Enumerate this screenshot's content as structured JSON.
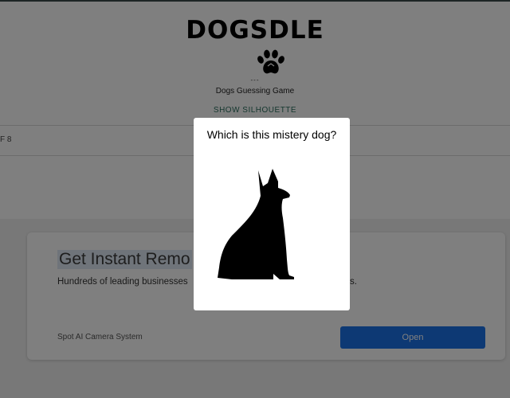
{
  "header": {
    "title": "DOGSDLE",
    "logo_icon": "paw-icon",
    "dashes": "---",
    "subtitle": "Dogs Guessing Game",
    "show_silhouette_label": "SHOW SILHOUETTE"
  },
  "game": {
    "progress_fragment": "F 8"
  },
  "ad": {
    "headline": "Get Instant Remo",
    "description": "Hundreds of leading businesses",
    "description_end": "s.",
    "brand": "Spot AI Camera System",
    "open_label": "Open"
  },
  "modal": {
    "title": "Which is this mistery dog?",
    "image_icon": "dog-silhouette-icon"
  },
  "colors": {
    "accent_link": "#2b6f5f",
    "ad_button": "#1a73e8",
    "overlay": "rgba(0,0,0,0.5)"
  }
}
